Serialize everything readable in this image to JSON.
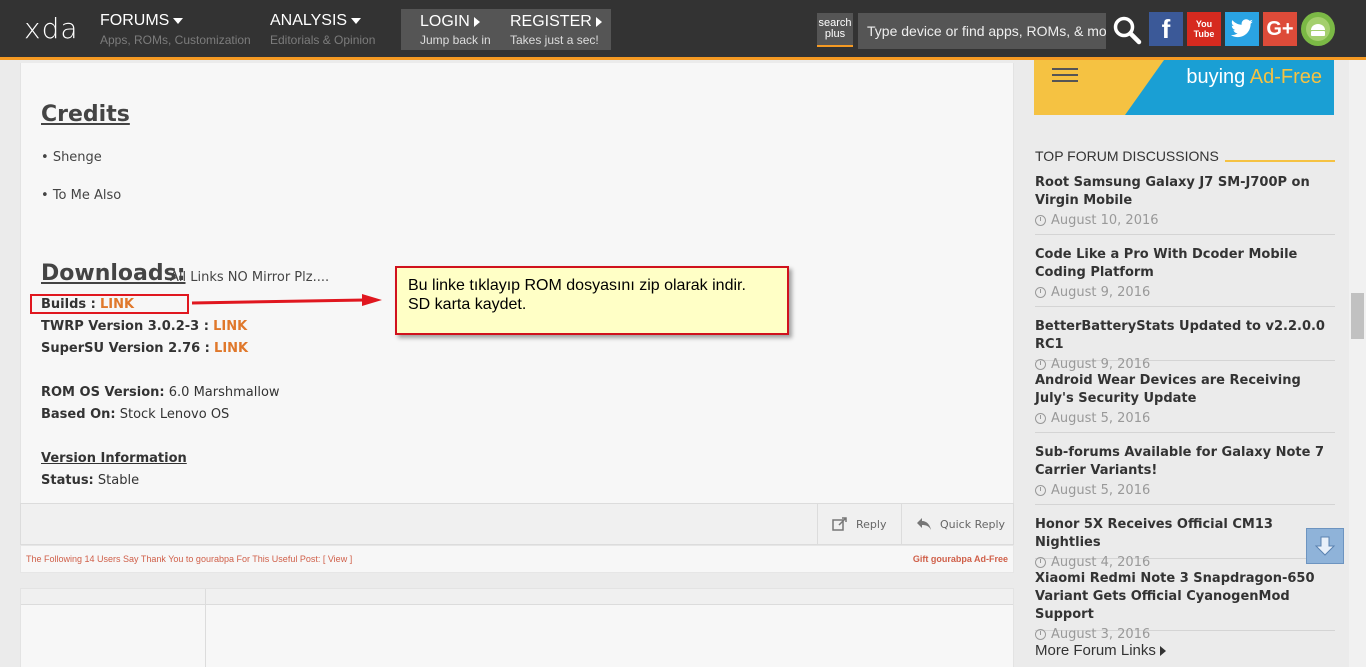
{
  "header": {
    "logo": "xda",
    "nav": [
      {
        "label": "FORUMS",
        "sub": "Apps, ROMs, Customization"
      },
      {
        "label": "ANALYSIS",
        "sub": "Editorials & Opinion"
      }
    ],
    "auth": [
      {
        "label": "LOGIN",
        "sub": "Jump back in"
      },
      {
        "label": "REGISTER",
        "sub": "Takes just a sec!"
      }
    ],
    "search_plus_line1": "search",
    "search_plus_line2": "plus",
    "search_placeholder": "Type device or find apps, ROMs, & more",
    "social": {
      "facebook": "f",
      "youtube": "You Tube",
      "google": "G+"
    }
  },
  "post": {
    "credits_heading": "Credits",
    "credits": [
      "Shenge",
      "To Me Also"
    ],
    "downloads_heading": "Downloads:",
    "downloads_note": "All Links NO Mirror Plz....",
    "links": [
      {
        "label": "Builds :",
        "link": "LINK"
      },
      {
        "label": "TWRP Version 3.0.2-3 :",
        "link": "LINK"
      },
      {
        "label": "SuperSU Version 2.76 :",
        "link": "LINK"
      }
    ],
    "rom_os_label": "ROM OS Version:",
    "rom_os_value": "6.0 Marshmallow",
    "based_on_label": "Based On:",
    "based_on_value": "Stock Lenovo OS",
    "version_info": "Version Information",
    "status_label": "Status:",
    "status_value": "Stable"
  },
  "annotation": {
    "line1": "Bu linke tıklayıp ROM dosyasını zip olarak indir.",
    "line2": "SD karta kaydet."
  },
  "actions": {
    "reply": "Reply",
    "quick_reply": "Quick Reply"
  },
  "thanks": {
    "text": "The Following 14 Users Say Thank You to gourabpa For This Useful Post:",
    "view": "[ View ]",
    "gift": "Gift gourabpa Ad-Free"
  },
  "sidebar": {
    "ad_text": "buying",
    "ad_accent": "Ad-Free",
    "title": "TOP FORUM DISCUSSIONS",
    "discussions": [
      {
        "title": "Root Samsung Galaxy J7 SM-J700P on Virgin Mobile",
        "date": "August 10, 2016"
      },
      {
        "title": "Code Like a Pro With Dcoder Mobile Coding Platform",
        "date": "August 9, 2016"
      },
      {
        "title": "BetterBatteryStats Updated to v2.2.0.0 RC1",
        "date": "August 9, 2016"
      },
      {
        "title": "Android Wear Devices are Receiving July's Security Update",
        "date": "August 5, 2016"
      },
      {
        "title": "Sub-forums Available for Galaxy Note 7 Carrier Variants!",
        "date": "August 5, 2016"
      },
      {
        "title": "Honor 5X Receives Official CM13 Nightlies",
        "date": "August 4, 2016"
      },
      {
        "title": "Xiaomi Redmi Note 3 Snapdragon-650 Variant Gets Official CyanogenMod Support",
        "date": "August 3, 2016"
      }
    ],
    "more_links": "More Forum Links"
  },
  "colors": {
    "accent": "#f59a23",
    "link": "#e0782b",
    "annotation_red": "#e0171f"
  }
}
